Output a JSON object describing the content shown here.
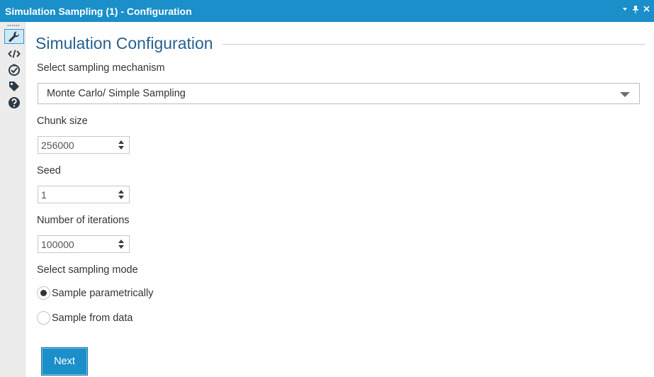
{
  "window": {
    "title": "Simulation Sampling (1) - Configuration",
    "actions": {
      "dropdown_icon": "chevron-down-icon",
      "pin_icon": "pin-icon",
      "close_icon": "close-icon"
    }
  },
  "sidebar": {
    "items": [
      {
        "name": "configuration",
        "icon": "wrench-icon",
        "active": true
      },
      {
        "name": "code",
        "icon": "code-icon",
        "active": false
      },
      {
        "name": "connections",
        "icon": "connection-icon",
        "active": false
      },
      {
        "name": "annotation",
        "icon": "tag-icon",
        "active": false
      },
      {
        "name": "help",
        "icon": "help-icon",
        "active": false
      }
    ]
  },
  "main": {
    "title": "Simulation Configuration",
    "mechanism": {
      "label": "Select sampling mechanism",
      "value": "Monte Carlo/ Simple Sampling"
    },
    "chunk_size": {
      "label": "Chunk size",
      "value": "256000"
    },
    "seed": {
      "label": "Seed",
      "value": "1"
    },
    "iterations": {
      "label": "Number of iterations",
      "value": "100000"
    },
    "sampling_mode": {
      "label": "Select sampling mode",
      "options": [
        {
          "label": "Sample parametrically",
          "checked": true
        },
        {
          "label": "Sample from data",
          "checked": false
        }
      ]
    },
    "next_label": "Next"
  },
  "colors": {
    "accent": "#1a8fc9",
    "title_text": "#27608f",
    "sidebar_bg": "#ececec"
  }
}
